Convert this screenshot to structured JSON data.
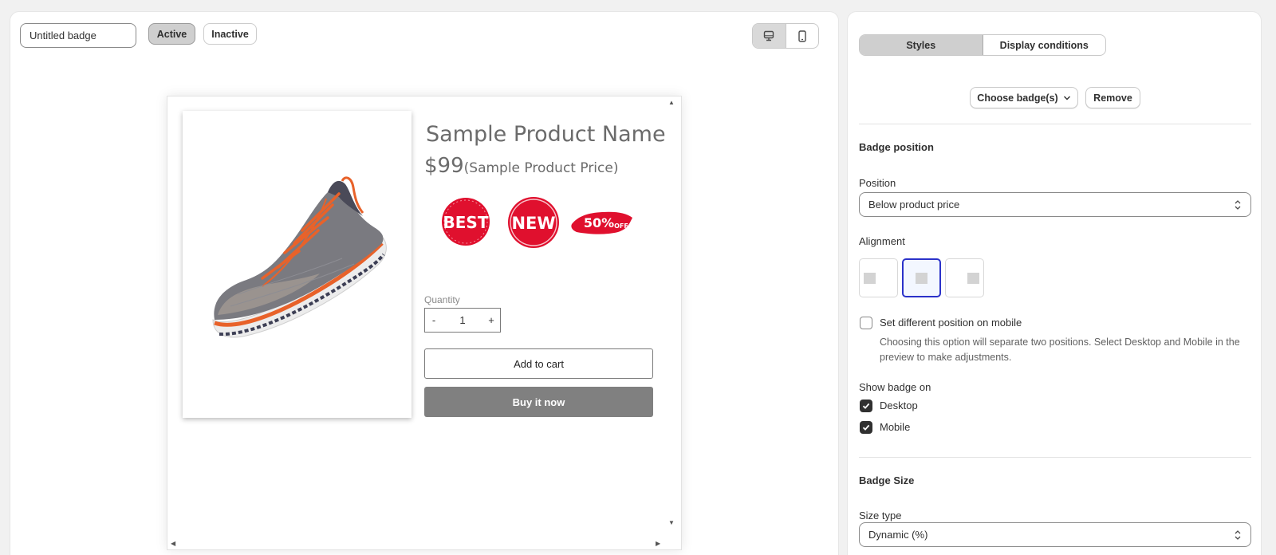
{
  "toolbar": {
    "badge_name_value": "Untitled badge",
    "active_label": "Active",
    "inactive_label": "Inactive",
    "desktop_icon": "desktop-icon",
    "mobile_icon": "mobile-icon"
  },
  "preview": {
    "product_name": "Sample Product Name",
    "price": "$99",
    "price_note": "(Sample Product Price)",
    "badges": [
      {
        "text": "BEST",
        "color": "#e0102e"
      },
      {
        "text": "NEW",
        "color": "#e0102e"
      },
      {
        "text": "50%",
        "suffix": "OFF",
        "color": "#e0102e"
      }
    ],
    "quantity_label": "Quantity",
    "quantity_minus": "-",
    "quantity_value": "1",
    "quantity_plus": "+",
    "add_to_cart": "Add to cart",
    "buy_now": "Buy it now"
  },
  "panel": {
    "tabs": [
      {
        "label": "Styles",
        "active": true
      },
      {
        "label": "Display conditions",
        "active": false
      }
    ],
    "choose_badges": "Choose badge(s)",
    "remove": "Remove",
    "badge_position_title": "Badge position",
    "position_label": "Position",
    "position_value": "Below product price",
    "alignment_label": "Alignment",
    "alignment_selected": "center",
    "mobile_position_label": "Set different position on mobile",
    "mobile_position_help": "Choosing this option will separate two positions. Select Desktop and Mobile in the preview to make adjustments.",
    "show_badge_on_label": "Show badge on",
    "desktop_label": "Desktop",
    "mobile_label": "Mobile",
    "desktop_checked": true,
    "mobile_checked": true,
    "mobile_position_checked": false,
    "badge_size_title": "Badge Size",
    "size_type_label": "Size type",
    "size_type_value": "Dynamic (%)"
  },
  "colors": {
    "accent_selected": "#2b32c9",
    "badge_red": "#e0102e",
    "buy_now_bg": "#808080"
  }
}
